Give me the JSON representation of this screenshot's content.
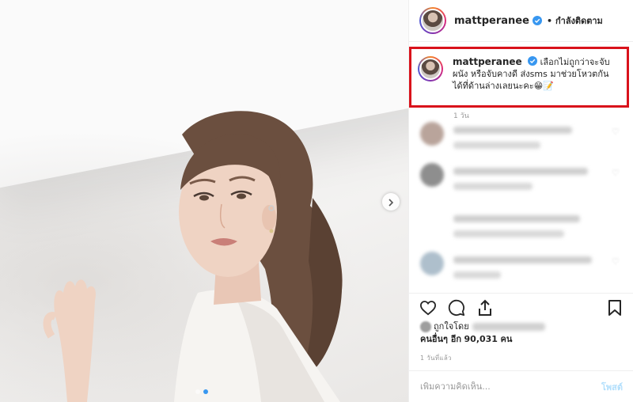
{
  "post": {
    "username": "mattperanee",
    "follow_separator": "•",
    "follow_status": "กำลังติดตาม",
    "caption": "เลือกไม่ถูกว่าจะจับผนัง หรือจับคางดี ส่งsms มาช่วยโหวตกันได้ที่ด้านล่างเลยนะคะ😁📝",
    "caption_time": "1 วัน",
    "carousel": {
      "total": 2,
      "current": 2
    }
  },
  "likes": {
    "liked_by_prefix": "ถูกใจโดย",
    "others_label": "คนอื่นๆ อีก",
    "count": "90,031",
    "unit": "คน"
  },
  "timestamp": "1 วันที่แล้ว",
  "comment_input": {
    "placeholder": "เพิ่มความคิดเห็น...",
    "post_label": "โพสต์"
  },
  "icons": {
    "verified": "verified-badge-icon",
    "like": "heart-icon",
    "comment": "comment-bubble-icon",
    "share": "share-icon",
    "save": "bookmark-icon",
    "more": "more-options-icon",
    "next": "chevron-right-icon"
  },
  "colors": {
    "highlight_border": "#d9121b",
    "verified": "#3897f0",
    "post_button": "#b2dffc"
  }
}
